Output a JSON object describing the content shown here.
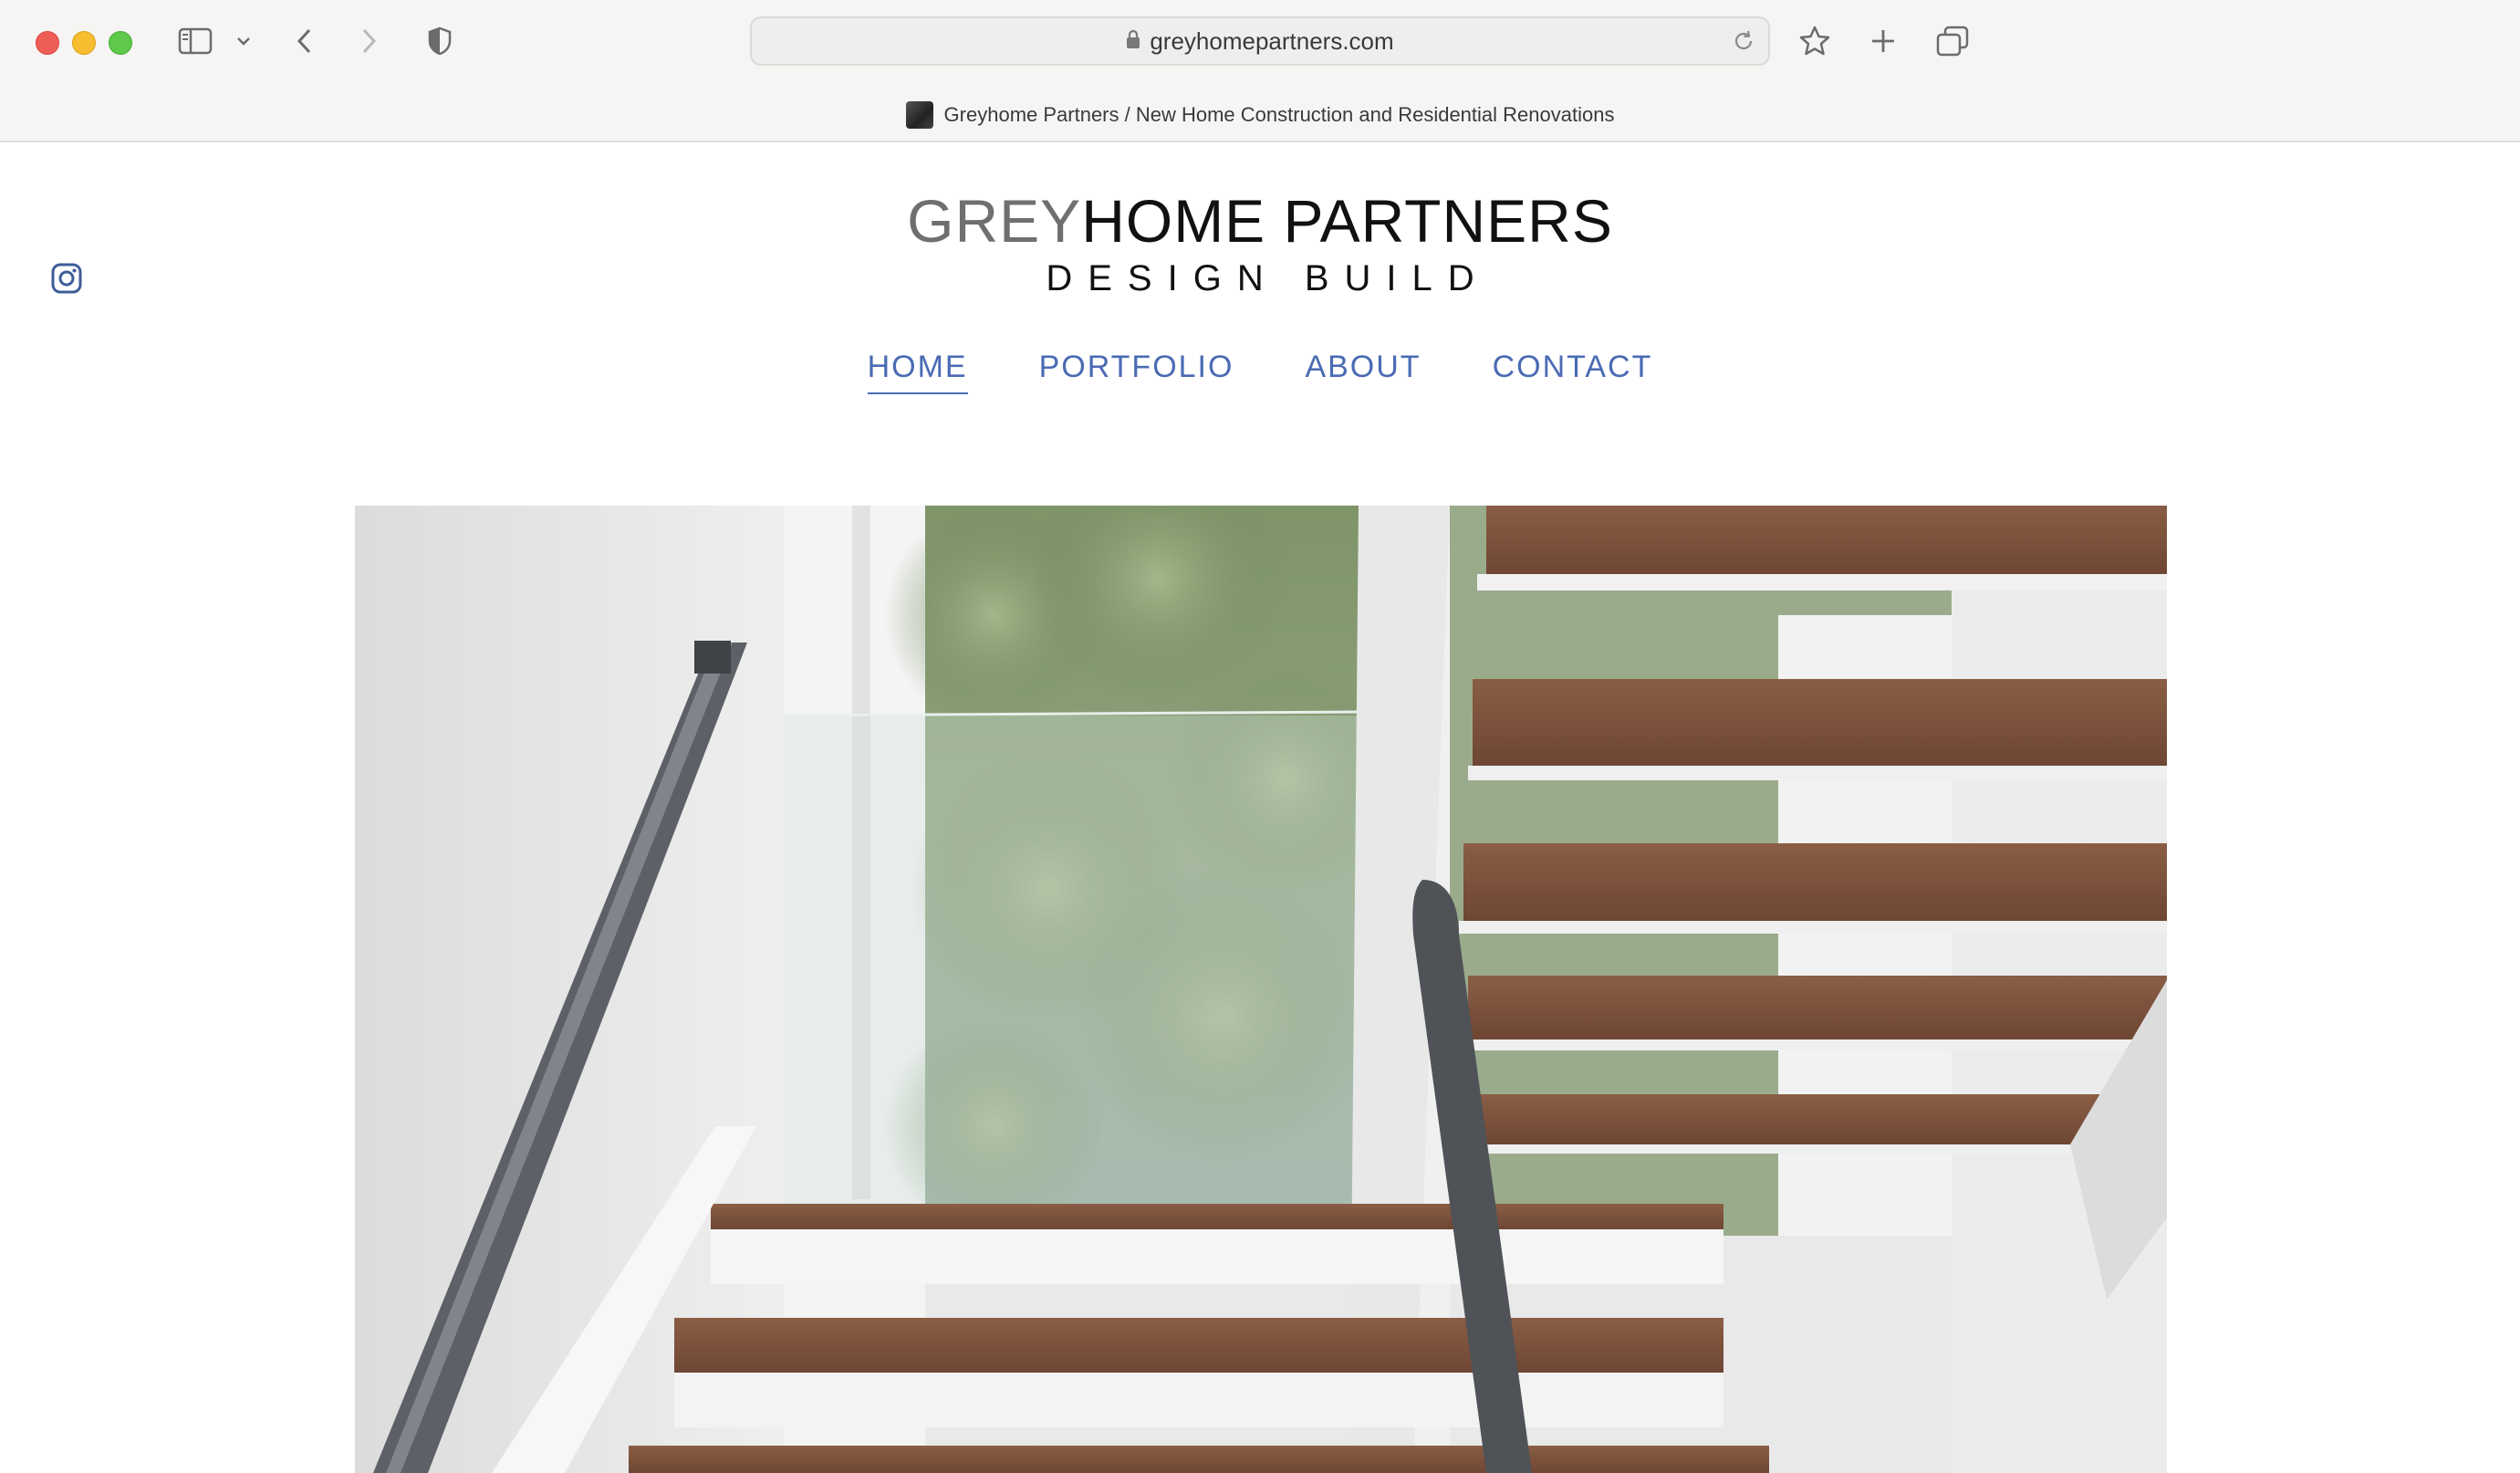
{
  "browser": {
    "url": "greyhomepartners.com",
    "tab_title": "Greyhome Partners / New Home Construction and Residential Renovations"
  },
  "site": {
    "logo_grey": "GREY",
    "logo_rest": "HOME PARTNERS",
    "tagline": "DESIGN BUILD",
    "social_icon": "instagram-icon"
  },
  "nav": {
    "items": [
      {
        "label": "HOME",
        "active": true
      },
      {
        "label": "PORTFOLIO",
        "active": false
      },
      {
        "label": "ABOUT",
        "active": false
      },
      {
        "label": "CONTACT",
        "active": false
      }
    ]
  },
  "colors": {
    "nav_link": "#4a6bb3",
    "logo_grey": "#6f6f6f",
    "logo_dark": "#111111"
  },
  "hero": {
    "subject": "photo"
  }
}
